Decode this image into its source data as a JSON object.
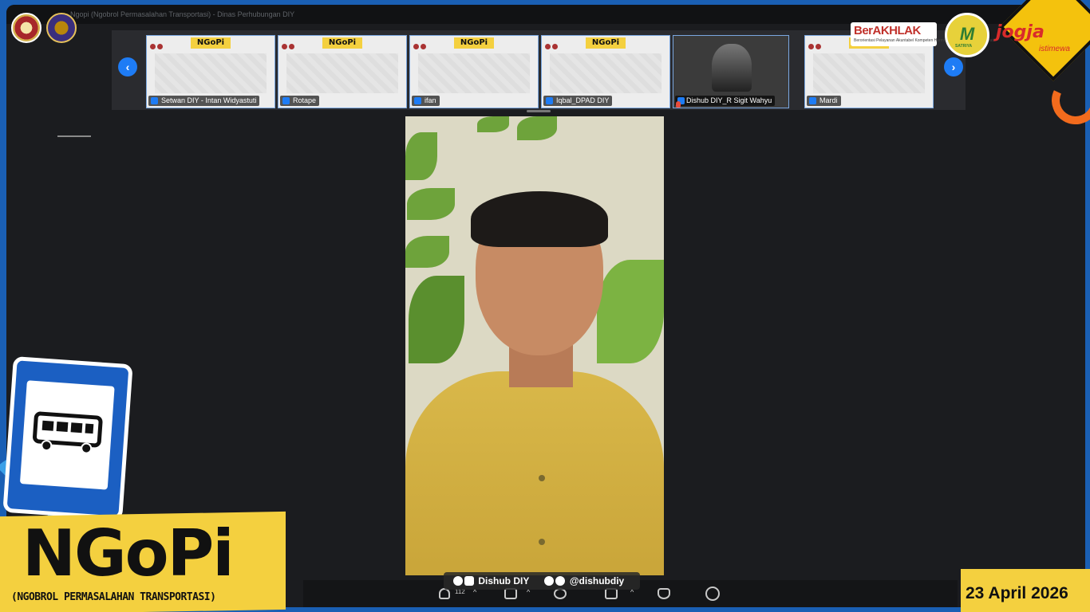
{
  "meeting": {
    "title_strip_text": "Ngopi (Ngobrol Permasalahan Transportasi) - Dinas Perhubungan DIY"
  },
  "thumbnails": [
    {
      "name": "Setwan DIY - Intan Widyastuti",
      "banner": "NGoPi"
    },
    {
      "name": "Rotape",
      "banner": "NGoPi"
    },
    {
      "name": "ifan",
      "banner": "NGoPi"
    },
    {
      "name": "Iqbal_DPAD DIY",
      "banner": "NGoPi"
    },
    {
      "name": "Dishub DIY_R Sigit Wahyu",
      "banner": ""
    },
    {
      "name": "Mardi",
      "banner": "NGoPi"
    }
  ],
  "navigation": {
    "prev_icon": "‹",
    "next_icon": "›"
  },
  "social": {
    "account_name": "Dishub DIY",
    "handle": "@dishubdiy"
  },
  "toolbar": {
    "participants_count": "112"
  },
  "branding": {
    "berakhlak": "BerAKHLAK",
    "berakhlak_sub": "Berorientasi Pelayanan Akuntabel Kompeten Harmonis Loyal Adaptif Kolaboratif",
    "satriya": "M",
    "satriya_sub": "SATRIYA",
    "jogja": "jogja",
    "jogja_sub": "istimewa"
  },
  "show": {
    "title": "NGoPi",
    "subtitle": "(NGOBROL PERMASALAHAN TRANSPORTASI)",
    "date": "23 April 2026"
  },
  "colors": {
    "accent_yellow": "#f4d03f",
    "zoom_blue": "#1e7cf5",
    "frame_blue": "#1a5fb4",
    "dark_bg": "#1b1c1f"
  }
}
